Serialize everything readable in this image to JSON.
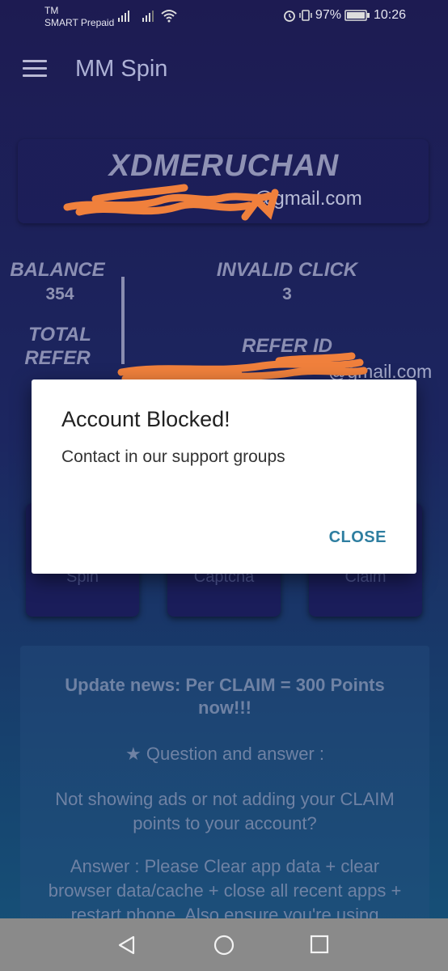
{
  "status_bar": {
    "carrier_line1": "TM",
    "carrier_line2": "SMART Prepaid",
    "battery": "97%",
    "time": "10:26"
  },
  "app_bar": {
    "title": "MM Spin",
    "menu_icon": "hamburger-menu-icon"
  },
  "profile": {
    "username": "XDMERUCHAN",
    "email_visible": "@gmail.com"
  },
  "stats": {
    "balance_label": "BALANCE",
    "balance_value": "354",
    "invalid_click_label": "INVALID CLICK",
    "invalid_click_value": "3",
    "total_refer_label_1": "TOTAL",
    "total_refer_label_2": "REFER",
    "refer_id_label": "REFER ID",
    "refer_id_email_visible": "@gmail.com"
  },
  "actions": [
    {
      "label": "Spin"
    },
    {
      "label": "Captcha"
    },
    {
      "label": "Claim"
    }
  ],
  "news": {
    "headline_1": "Update news: Per CLAIM = 300 Points",
    "headline_2": "now!!!",
    "qa_title": "★ Question and answer :",
    "question_1": "Not showing ads or not adding your CLAIM",
    "question_2": "points to your account?",
    "answer_1": "Answer : Please Clear app data + clear",
    "answer_2": "browser data/cache + close all recent apps +",
    "answer_3": "restart phone. Also ensure you're using"
  },
  "dialog": {
    "title": "Account Blocked!",
    "message": "Contact in our support groups",
    "button": "CLOSE"
  },
  "colors": {
    "background_top": "#1d1b52",
    "background_bottom": "#155379",
    "dialog_button": "#2e7ea0",
    "scribble": "#f0803c"
  }
}
